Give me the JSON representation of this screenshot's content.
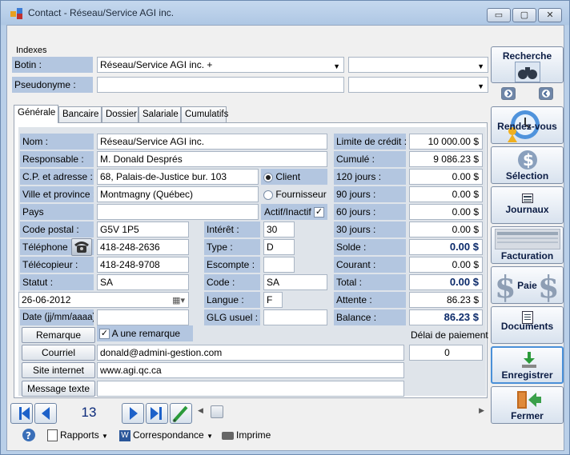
{
  "window": {
    "title": "Contact - Réseau/Service AGI inc.",
    "min": "▭",
    "max": "▢",
    "close": "✕"
  },
  "indexes": {
    "group_label": "Indexes",
    "botin_label": "Botin :",
    "botin_value": "Réseau/Service AGI inc.  +",
    "pseudonyme_label": "Pseudonyme :",
    "pseudonyme_value": "",
    "botin_extra": "",
    "pseudonyme_extra": ""
  },
  "tabs": [
    "Générale",
    "Bancaire",
    "Dossier",
    "Salariale",
    "Cumulatifs"
  ],
  "form": {
    "nom_label": "Nom :",
    "nom": "Réseau/Service AGI inc.",
    "responsable_label": "Responsable :",
    "responsable": "M. Donald Després",
    "cp_label": "C.P. et adresse :",
    "adresse": "68, Palais-de-Justice bur. 103",
    "ville_label": "Ville et province :",
    "ville": "Montmagny (Québec)",
    "pays_label": "Pays",
    "pays": "",
    "client_label": "Client",
    "fournisseur_label": "Fournisseur",
    "actif_label": "Actif/Inactif",
    "actif_check": "✓",
    "code_postal_label": "Code postal :",
    "code_postal": "G5V 1P5",
    "telephone_label": "Téléphone :",
    "telephone": "418-248-2636",
    "telecopieur_label": "Télécopieur :",
    "telecopieur": "418-248-9708",
    "statut_label": "Statut :",
    "statut": "SA",
    "date_value": "26-06-2012",
    "date_label": "Date (jj/mm/aaaa):",
    "date2": "",
    "interet_label": "Intérêt :",
    "interet": "30",
    "type_label": "Type :",
    "type": "D",
    "escompte_label": "Escompte :",
    "escompte": "",
    "code_label": "Code :",
    "code": "SA",
    "langue_label": "Langue :",
    "langue": "F",
    "glg_label": "GLG usuel :",
    "glg": "",
    "remarque_button": "Remarque",
    "une_remarque_label": "A une remarque",
    "remarque_check": "✓",
    "courriel_button": "Courriel",
    "courriel": "donald@admini-gestion.com",
    "site_button": "Site internet",
    "site": "www.agi.qc.ca",
    "message_button": "Message texte",
    "message": ""
  },
  "finance": {
    "limite_label": "Limite de crédit :",
    "limite": "10 000.00 $",
    "cumule_label": "Cumulé :",
    "cumule": "9 086.23 $",
    "j120_label": "120 jours :",
    "j120": "0.00 $",
    "j90_label": "90 jours :",
    "j90": "0.00 $",
    "j60_label": "60 jours :",
    "j60": "0.00 $",
    "j30_label": "30 jours :",
    "j30": "0.00 $",
    "solde_label": "Solde :",
    "solde": "0.00 $",
    "courant_label": "Courant :",
    "courant": "0.00 $",
    "total_label": "Total :",
    "total": "0.00 $",
    "attente_label": "Attente :",
    "attente": "86.23 $",
    "balance_label": "Balance :",
    "balance": "86.23 $",
    "delai_label": "Délai de paiement",
    "delai": "0"
  },
  "side_buttons": {
    "recherche": "Recherche",
    "rendezvous": "Rendez-vous",
    "selection": "Sélection",
    "journaux": "Journaux",
    "facturation": "Facturation",
    "paie": "Paie",
    "documents": "Documents",
    "enregistrer": "Enregistrer",
    "fermer": "Fermer"
  },
  "navigation": {
    "record": "13"
  },
  "toolbar": {
    "rapports": "Rapports",
    "correspondance": "Correspondance",
    "imprime": "Imprime"
  },
  "colors": {
    "accent": "#1d61c9",
    "label_bg": "#b3c6e0"
  }
}
